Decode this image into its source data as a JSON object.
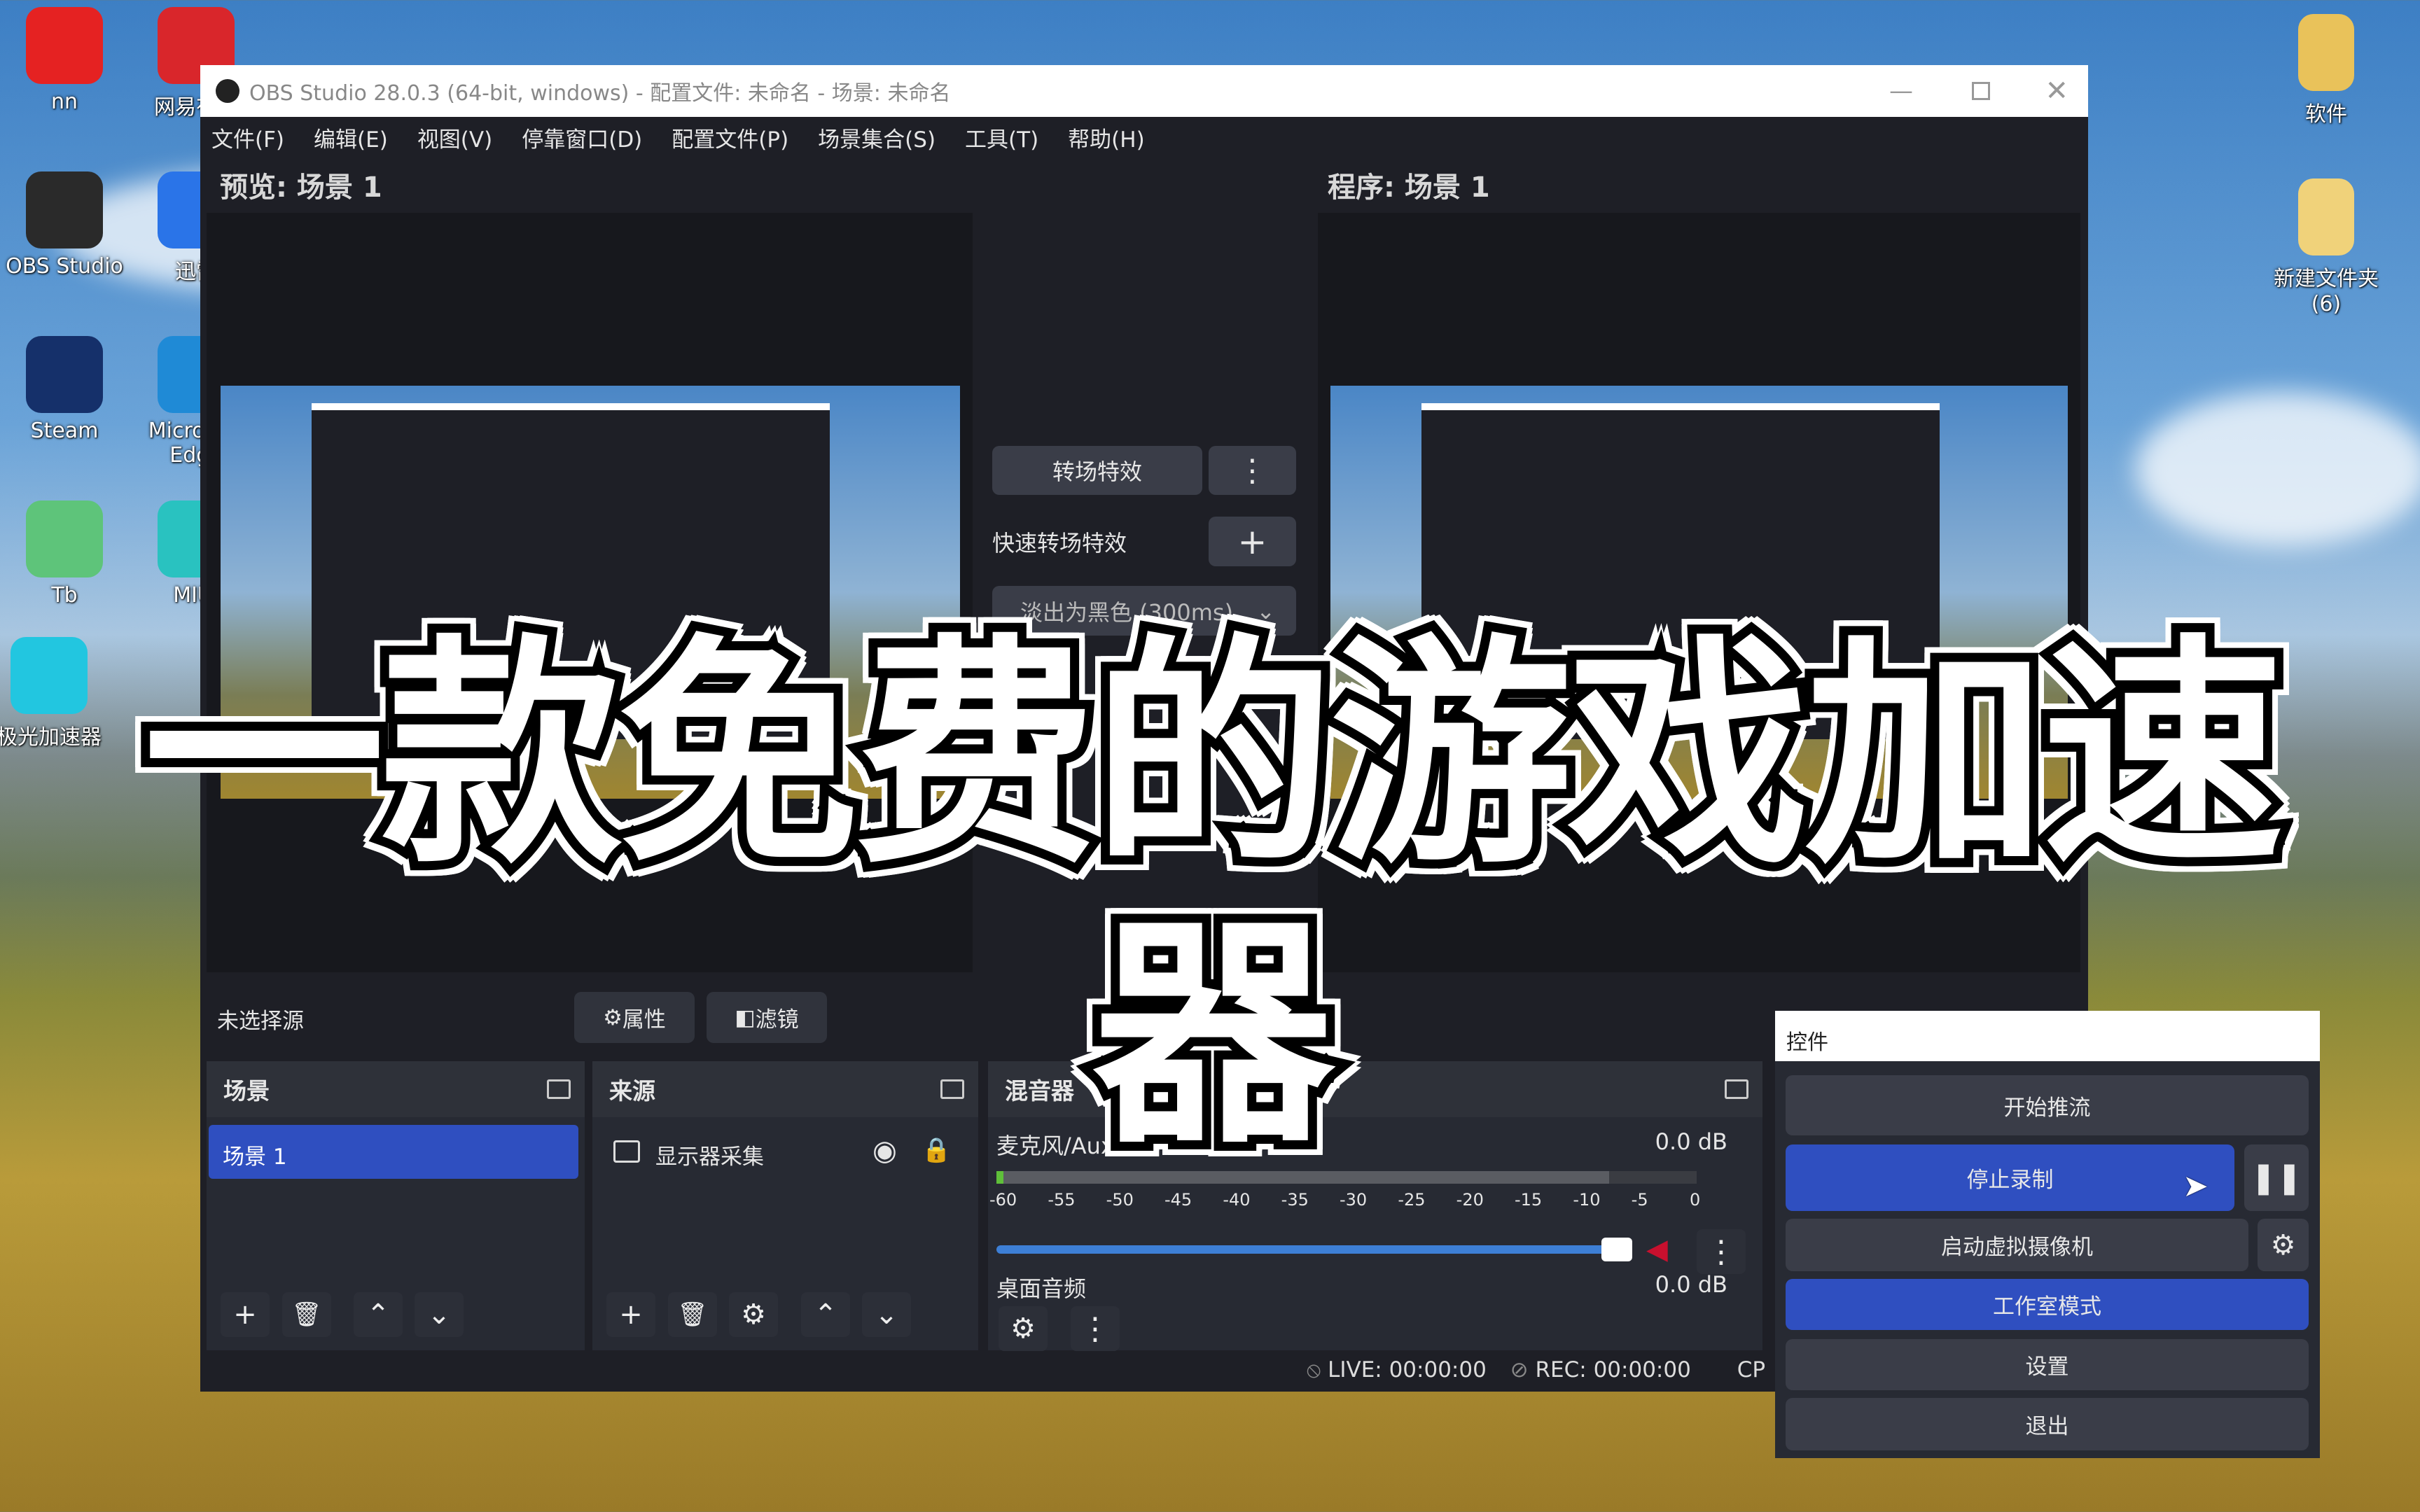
{
  "desktop": {
    "left_icons": [
      {
        "label": "nn",
        "color": "#e52222"
      },
      {
        "label": "网易有道",
        "color": "#d9262b"
      },
      {
        "label": "OBS Studio",
        "color": "#2a2a2a"
      },
      {
        "label": "迅雷",
        "color": "#2a74e8"
      },
      {
        "label": "Steam",
        "color": "#15306a"
      },
      {
        "label": "Microsoft Edge",
        "color": "#1f8ad6"
      },
      {
        "label": "Tb",
        "color": "#5ec47a"
      },
      {
        "label": "MIUI",
        "color": "#29c2c0"
      },
      {
        "label": "极光加速器",
        "color": "#22c6e0"
      }
    ],
    "right_icons": [
      {
        "label": "软件",
        "color": "#e9c25a"
      },
      {
        "label": "新建文件夹\n(6)",
        "color": "#f0d27a"
      }
    ]
  },
  "window": {
    "title": "OBS Studio 28.0.3 (64-bit, windows) - 配置文件: 未命名 - 场景: 未命名",
    "menu": [
      "文件(F)",
      "编辑(E)",
      "视图(V)",
      "停靠窗口(D)",
      "配置文件(P)",
      "场景集合(S)",
      "工具(T)",
      "帮助(H)"
    ],
    "preview_label": "预览: 场景 1",
    "program_label": "程序: 场景 1",
    "transition": {
      "button": "转场特效",
      "quick_label": "快速转场特效",
      "selected": "淡出为黑色 (300ms)"
    },
    "source_bar": {
      "status": "未选择源",
      "properties": "属性",
      "filters": "滤镜"
    },
    "scenes": {
      "title": "场景",
      "items": [
        "场景 1"
      ]
    },
    "sources": {
      "title": "来源",
      "items": [
        "显示器采集"
      ]
    },
    "mixer": {
      "title": "混音器",
      "channels": [
        {
          "name": "麦克风/Aux",
          "db": "0.0 dB",
          "volume_percent": 95
        },
        {
          "name": "桌面音频",
          "db": "0.0 dB"
        }
      ],
      "ticks": [
        "-60",
        "-55",
        "-50",
        "-45",
        "-40",
        "-35",
        "-30",
        "-25",
        "-20",
        "-15",
        "-10",
        "-5",
        "0"
      ]
    },
    "status": {
      "live": "LIVE: 00:00:00",
      "rec": "REC: 00:00:00",
      "cpu": "CP"
    }
  },
  "controls": {
    "title": "控件",
    "start_stream": "开始推流",
    "stop_record": "停止录制",
    "virtual_cam": "启动虚拟摄像机",
    "studio_mode": "工作室模式",
    "settings": "设置",
    "exit": "退出"
  },
  "overlay_caption": "一款免费的游戏加速器",
  "colors": {
    "accent": "#2f4fc0",
    "panel": "#272a33",
    "meter_green": "#5fbf3a",
    "volume_bar": "#3d7fd6",
    "muted_red": "#c8102e"
  }
}
